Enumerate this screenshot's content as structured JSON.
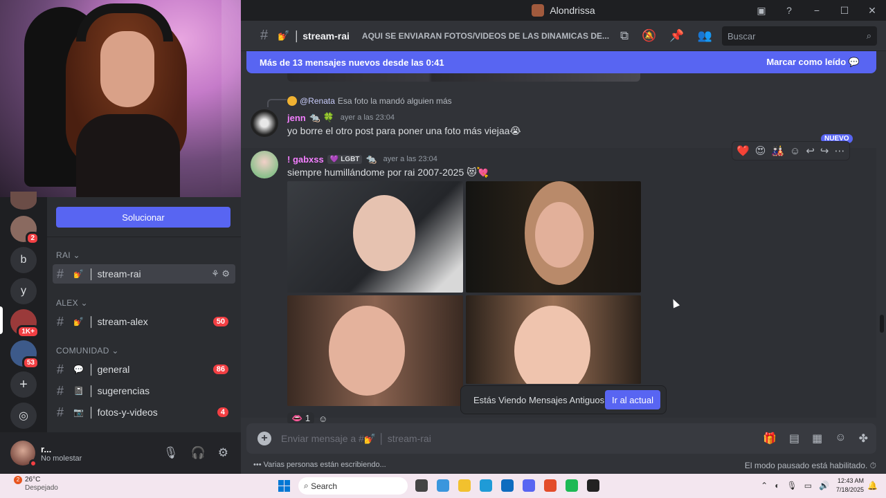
{
  "window": {
    "title": "Alondrissa",
    "controls": [
      "−",
      "☐",
      "✕"
    ]
  },
  "servers": [
    {
      "letter": "",
      "badge": "2"
    },
    {
      "letter": "b",
      "badge": ""
    },
    {
      "letter": "y",
      "badge": ""
    },
    {
      "letter": "",
      "badge": "1K+"
    },
    {
      "letter": "",
      "badge": "53"
    }
  ],
  "sidebar": {
    "solve_button": "Solucionar",
    "categories": [
      "RAI",
      "ALEX",
      "COMUNIDAD"
    ],
    "channels": [
      {
        "emoji": "💅",
        "name": "stream-rai",
        "count": ""
      },
      {
        "emoji": "💅",
        "name": "stream-alex",
        "count": "50"
      },
      {
        "emoji": "💬",
        "name": "general",
        "count": "86"
      },
      {
        "emoji": "📓",
        "name": "sugerencias",
        "count": ""
      },
      {
        "emoji": "📷",
        "name": "fotos-y-videos",
        "count": "4"
      }
    ]
  },
  "user": {
    "name": "r...",
    "status": "No molestar"
  },
  "channel_header": {
    "name": "stream-rai",
    "topic": "AQUI SE ENVIARAN FOTOS/VIDEOS DE LAS DINAMICAS DE...",
    "search_placeholder": "Buscar"
  },
  "new_messages_bar": {
    "text": "Más de 13 mensajes nuevos desde las 0:41",
    "mark_read": "Marcar como leído"
  },
  "messages": [
    {
      "reply_mention": "@Renata",
      "reply_text": "Esa foto la mandó alguien más",
      "author": "jenn",
      "author_color": "#f47fff",
      "time": "ayer a las 23:04",
      "text": "yo borre el otro post para poner una foto más viejaa😭"
    },
    {
      "author": "! gabxss",
      "author_color": "#f47fff",
      "tag": "LGBT",
      "time": "ayer a las 23:04",
      "text": "siempre humillándome por rai 2007-2025 😻💘",
      "reaction_count": "1"
    }
  ],
  "new_badge": "NUEVO",
  "old_messages_toast": {
    "text": "Estás Viendo Mensajes Antiguos",
    "button": "Ir al actual"
  },
  "composer": {
    "placeholder": "Enviar mensaje a #💅 │ stream-rai"
  },
  "status_line": {
    "typing": "Varias personas están escribiendo...",
    "paused": "El modo pausado está habilitado."
  },
  "taskbar": {
    "weather_temp": "26°C",
    "weather_desc": "Despejado",
    "weather_badge": "2",
    "search": "Search",
    "time": "12:43 AM",
    "date": "7/18/2025"
  },
  "colors": {
    "blurple": "#5865f2",
    "red_badge": "#f23f43",
    "background": "#313338"
  }
}
